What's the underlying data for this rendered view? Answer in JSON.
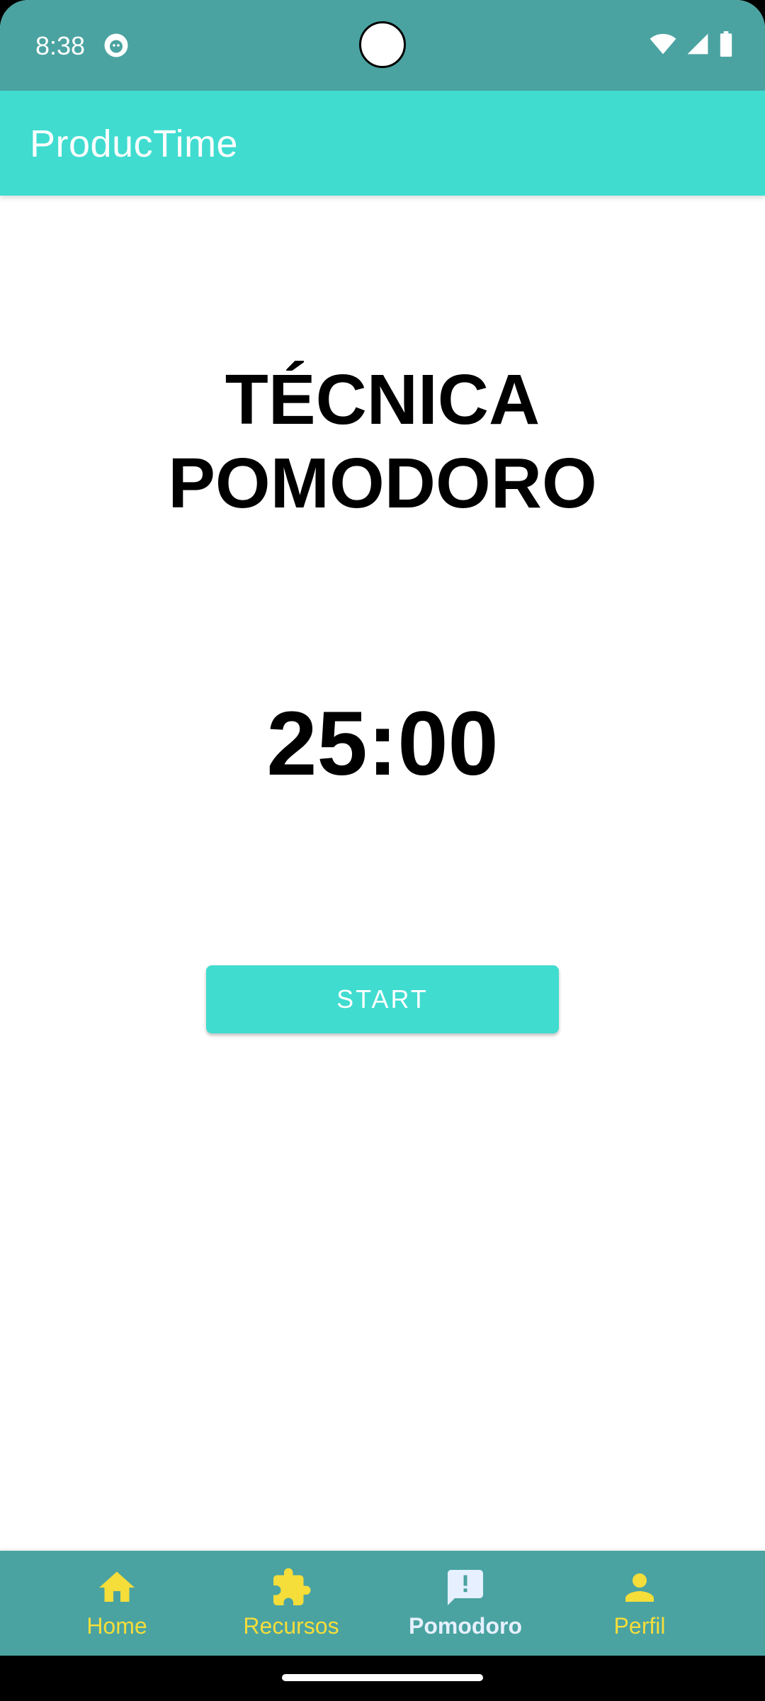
{
  "status_bar": {
    "time": "8:38",
    "icons": [
      "app-notification-icon",
      "wifi-icon",
      "cellular-signal-icon",
      "battery-icon"
    ]
  },
  "app_bar": {
    "title": "ProducTime",
    "background_color": "#40dcd0"
  },
  "main": {
    "heading_line1": "TÉCNICA",
    "heading_line2": "POMODORO",
    "timer": "25:00",
    "start_label": "START"
  },
  "bottom_nav": {
    "background_color": "#4aa3a1",
    "label_color": "#f5dd3a",
    "active_label_color": "#e6f0ff",
    "items": [
      {
        "label": "Home",
        "icon": "home-icon",
        "active": false
      },
      {
        "label": "Recursos",
        "icon": "puzzle-icon",
        "active": false
      },
      {
        "label": "Pomodoro",
        "icon": "feedback-icon",
        "active": true
      },
      {
        "label": "Perfil",
        "icon": "person-icon",
        "active": false
      }
    ]
  }
}
